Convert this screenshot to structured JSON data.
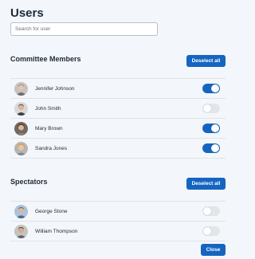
{
  "page": {
    "title": "Users"
  },
  "search": {
    "placeholder": "Search for user",
    "value": ""
  },
  "committee": {
    "title": "Committee Members",
    "deselect_label": "Deselect all",
    "members": [
      {
        "name": "Jennifer Johnson",
        "enabled": true,
        "avatar": "avatar-woman-gray-hair"
      },
      {
        "name": "John Smith",
        "enabled": false,
        "avatar": "avatar-man-dark-hair"
      },
      {
        "name": "Mary Brown",
        "enabled": true,
        "avatar": "avatar-woman-brown-hair"
      },
      {
        "name": "Sandra Jones",
        "enabled": true,
        "avatar": "avatar-woman-blonde-hair"
      }
    ]
  },
  "spectators": {
    "title": "Spectators",
    "deselect_label": "Deselect all",
    "members": [
      {
        "name": "George Stone",
        "enabled": false,
        "avatar": "avatar-man-blue-bg"
      },
      {
        "name": "William Thompson",
        "enabled": false,
        "avatar": "avatar-man-gray-bg"
      }
    ]
  },
  "footer": {
    "close_label": "Close"
  },
  "colors": {
    "accent": "#1565c0",
    "toggle_off": "#e3e5e8",
    "background": "#f3f6fb"
  }
}
